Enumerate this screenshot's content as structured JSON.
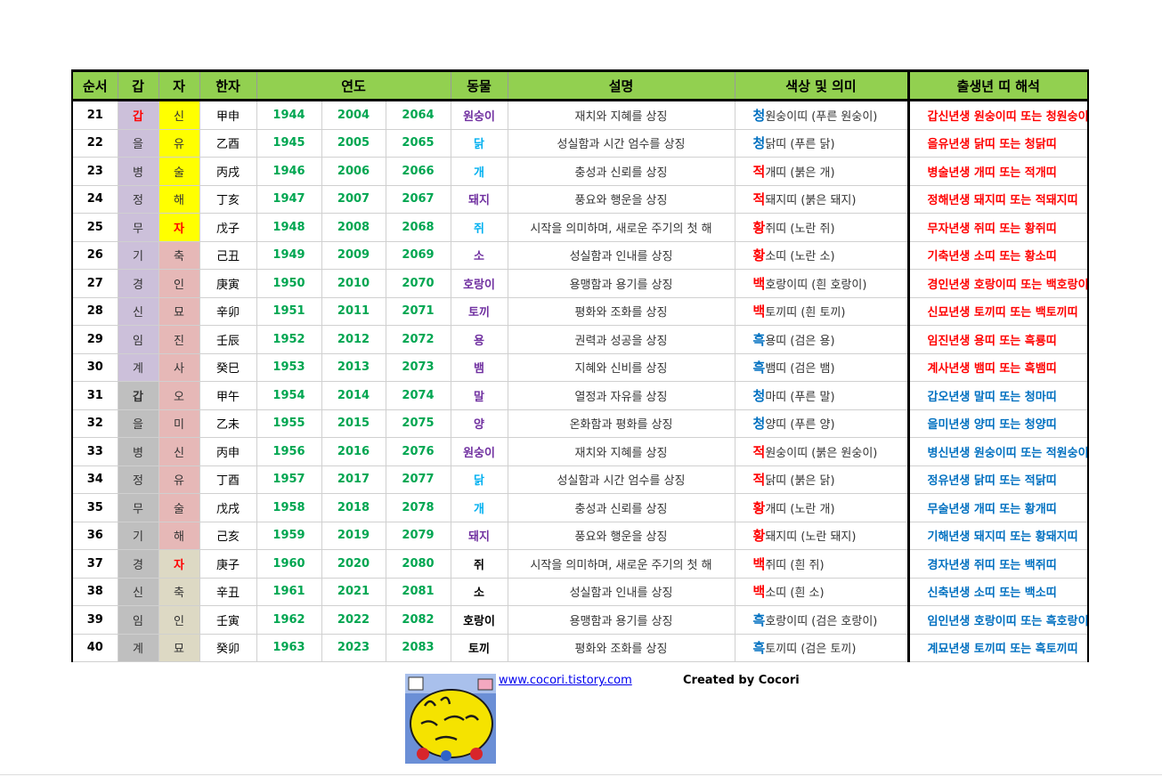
{
  "headers": {
    "order": "순서",
    "gan": "갑",
    "ja": "자",
    "hanja": "한자",
    "year": "연도",
    "animal": "동물",
    "desc": "설명",
    "color": "색상 및 의미",
    "interp": "출생년 띠 해석"
  },
  "colors": {
    "header_bg": "#92d050",
    "year_green": "#00a651",
    "red": "#ff0000",
    "blue": "#0070c0",
    "purple": "#7030a0",
    "cyan": "#00b0f0",
    "lavender": "#ccc0da",
    "yellow": "#ffff00",
    "pink": "#e6b8b7",
    "gray": "#bfbfbf",
    "beige": "#ddd9c4"
  },
  "rows": [
    {
      "n": "21",
      "gan": "갑",
      "ja": "신",
      "hanja": "甲申",
      "y1": "1944",
      "y2": "2004",
      "y3": "2064",
      "animal": "원숭이",
      "desc": "재치와 지혜를 상징",
      "c1": "청",
      "c2": "원숭이띠 (푸른 원숭이)",
      "interp": "갑신년생 원숭이띠 또는 청원숭이띠"
    },
    {
      "n": "22",
      "gan": "을",
      "ja": "유",
      "hanja": "乙酉",
      "y1": "1945",
      "y2": "2005",
      "y3": "2065",
      "animal": "닭",
      "desc": "성실함과 시간 엄수를 상징",
      "c1": "청",
      "c2": "닭띠 (푸른 닭)",
      "interp": "을유년생 닭띠 또는 청닭띠"
    },
    {
      "n": "23",
      "gan": "병",
      "ja": "술",
      "hanja": "丙戌",
      "y1": "1946",
      "y2": "2006",
      "y3": "2066",
      "animal": "개",
      "desc": "충성과 신뢰를 상징",
      "c1": "적",
      "c2": "개띠 (붉은 개)",
      "interp": "병술년생 개띠 또는 적개띠"
    },
    {
      "n": "24",
      "gan": "정",
      "ja": "해",
      "hanja": "丁亥",
      "y1": "1947",
      "y2": "2007",
      "y3": "2067",
      "animal": "돼지",
      "desc": "풍요와 행운을 상징",
      "c1": "적",
      "c2": "돼지띠 (붉은 돼지)",
      "interp": "정해년생 돼지띠 또는 적돼지띠"
    },
    {
      "n": "25",
      "gan": "무",
      "ja": "자",
      "hanja": "戊子",
      "y1": "1948",
      "y2": "2008",
      "y3": "2068",
      "animal": "쥐",
      "desc": "시작을 의미하며, 새로운 주기의 첫 해",
      "c1": "황",
      "c2": "쥐띠 (노란 쥐)",
      "interp": "무자년생 쥐띠 또는 황쥐띠"
    },
    {
      "n": "26",
      "gan": "기",
      "ja": "축",
      "hanja": "己丑",
      "y1": "1949",
      "y2": "2009",
      "y3": "2069",
      "animal": "소",
      "desc": "성실함과 인내를 상징",
      "c1": "황",
      "c2": "소띠 (노란 소)",
      "interp": "기축년생 소띠 또는 황소띠"
    },
    {
      "n": "27",
      "gan": "경",
      "ja": "인",
      "hanja": "庚寅",
      "y1": "1950",
      "y2": "2010",
      "y3": "2070",
      "animal": "호랑이",
      "desc": "용맹함과 용기를 상징",
      "c1": "백",
      "c2": "호랑이띠 (흰 호랑이)",
      "interp": "경인년생 호랑이띠 또는 백호랑이띠"
    },
    {
      "n": "28",
      "gan": "신",
      "ja": "묘",
      "hanja": "辛卯",
      "y1": "1951",
      "y2": "2011",
      "y3": "2071",
      "animal": "토끼",
      "desc": "평화와 조화를 상징",
      "c1": "백",
      "c2": "토끼띠 (흰 토끼)",
      "interp": "신묘년생 토끼띠 또는 백토끼띠"
    },
    {
      "n": "29",
      "gan": "임",
      "ja": "진",
      "hanja": "壬辰",
      "y1": "1952",
      "y2": "2012",
      "y3": "2072",
      "animal": "용",
      "desc": "권력과 성공을 상징",
      "c1": "흑",
      "c2": "용띠 (검은 용)",
      "interp": "임진년생 용띠 또는 흑룡띠"
    },
    {
      "n": "30",
      "gan": "계",
      "ja": "사",
      "hanja": "癸巳",
      "y1": "1953",
      "y2": "2013",
      "y3": "2073",
      "animal": "뱀",
      "desc": "지혜와 신비를 상징",
      "c1": "흑",
      "c2": "뱀띠 (검은 뱀)",
      "interp": "계사년생 뱀띠 또는 흑뱀띠"
    },
    {
      "n": "31",
      "gan": "갑",
      "ja": "오",
      "hanja": "甲午",
      "y1": "1954",
      "y2": "2014",
      "y3": "2074",
      "animal": "말",
      "desc": "열정과 자유를 상징",
      "c1": "청",
      "c2": "마띠 (푸른 말)",
      "interp": "갑오년생 말띠 또는 청마띠"
    },
    {
      "n": "32",
      "gan": "을",
      "ja": "미",
      "hanja": "乙未",
      "y1": "1955",
      "y2": "2015",
      "y3": "2075",
      "animal": "양",
      "desc": "온화함과 평화를 상징",
      "c1": "청",
      "c2": "양띠 (푸른 양)",
      "interp": "을미년생 양띠 또는 청양띠"
    },
    {
      "n": "33",
      "gan": "병",
      "ja": "신",
      "hanja": "丙申",
      "y1": "1956",
      "y2": "2016",
      "y3": "2076",
      "animal": "원숭이",
      "desc": "재치와 지혜를 상징",
      "c1": "적",
      "c2": "원숭이띠 (붉은 원숭이)",
      "interp": "병신년생 원숭이띠 또는 적원숭이띠"
    },
    {
      "n": "34",
      "gan": "정",
      "ja": "유",
      "hanja": "丁酉",
      "y1": "1957",
      "y2": "2017",
      "y3": "2077",
      "animal": "닭",
      "desc": "성실함과 시간 엄수를 상징",
      "c1": "적",
      "c2": "닭띠 (붉은 닭)",
      "interp": "정유년생 닭띠 또는 적닭띠"
    },
    {
      "n": "35",
      "gan": "무",
      "ja": "술",
      "hanja": "戊戌",
      "y1": "1958",
      "y2": "2018",
      "y3": "2078",
      "animal": "개",
      "desc": "충성과 신뢰를 상징",
      "c1": "황",
      "c2": "개띠 (노란 개)",
      "interp": "무술년생 개띠 또는 황개띠"
    },
    {
      "n": "36",
      "gan": "기",
      "ja": "해",
      "hanja": "己亥",
      "y1": "1959",
      "y2": "2019",
      "y3": "2079",
      "animal": "돼지",
      "desc": "풍요와 행운을 상징",
      "c1": "황",
      "c2": "돼지띠 (노란 돼지)",
      "interp": "기해년생 돼지띠 또는 황돼지띠"
    },
    {
      "n": "37",
      "gan": "경",
      "ja": "자",
      "hanja": "庚子",
      "y1": "1960",
      "y2": "2020",
      "y3": "2080",
      "animal": "쥐",
      "desc": "시작을 의미하며, 새로운 주기의 첫 해",
      "c1": "백",
      "c2": "쥐띠 (흰 쥐)",
      "interp": "경자년생 쥐띠 또는 백쥐띠"
    },
    {
      "n": "38",
      "gan": "신",
      "ja": "축",
      "hanja": "辛丑",
      "y1": "1961",
      "y2": "2021",
      "y3": "2081",
      "animal": "소",
      "desc": "성실함과 인내를 상징",
      "c1": "백",
      "c2": "소띠 (흰 소)",
      "interp": "신축년생 소띠 또는 백소띠"
    },
    {
      "n": "39",
      "gan": "임",
      "ja": "인",
      "hanja": "壬寅",
      "y1": "1962",
      "y2": "2022",
      "y3": "2082",
      "animal": "호랑이",
      "desc": "용맹함과 용기를 상징",
      "c1": "흑",
      "c2": "호랑이띠 (검은 호랑이)",
      "interp": "임인년생 호랑이띠 또는 흑호랑이띠"
    },
    {
      "n": "40",
      "gan": "계",
      "ja": "묘",
      "hanja": "癸卯",
      "y1": "1963",
      "y2": "2023",
      "y3": "2083",
      "animal": "토끼",
      "desc": "평화와 조화를 상징",
      "c1": "흑",
      "c2": "토끼띠 (검은 토끼)",
      "interp": "계묘년생 토끼띠 또는 흑토끼띠"
    }
  ],
  "footer": {
    "link": "www.cocori.tistory.com",
    "credit": "Created by Cocori",
    "logo_icon": "b-grade-sensibility-logo"
  }
}
